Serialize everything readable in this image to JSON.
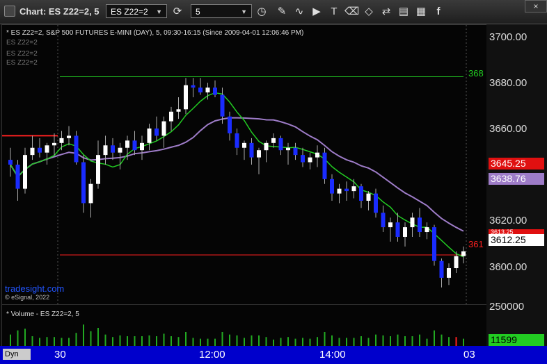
{
  "toolbar": {
    "title": "Chart: ES Z22=2, 5",
    "symbol": "ES Z22=2",
    "interval": "5",
    "buttons": [
      "draw",
      "indicators",
      "play",
      "text",
      "eraser",
      "tag",
      "save",
      "facebook"
    ]
  },
  "chart": {
    "header": "* ES Z22=2, S&P 500 FUTURES E-MINI (DAY), 5, 09:30-16:15 (Since 2009-04-01 12:06:46 PM)",
    "legend_items": [
      "ES Z22=2",
      "ES Z22=2",
      "ES Z22=2"
    ],
    "watermark": "tradesight.com",
    "copyright": "© eSignal, 2022",
    "green_line_label": "368",
    "red_line_label": "361",
    "volume_header": "* Volume - ES Z22=2, 5",
    "dyn_label": "Dyn"
  },
  "axis": {
    "price_labels": [
      "3700.00",
      "3680.00",
      "3660.00",
      "3620.00",
      "3600.00"
    ],
    "volume_label": "250000",
    "tag_red": "3645.25",
    "tag_purple": "3638.76",
    "tag_hidden": "3613.25",
    "tag_last": "3612.25",
    "tag_volume": "11599"
  },
  "time_labels": [
    "30",
    "12:00",
    "14:00",
    "03"
  ],
  "colors": {
    "red": "#ff2020",
    "green": "#22cc22",
    "purple": "#9e7cc8",
    "candle_up": "#ffffff",
    "candle_down": "#1a2cff"
  },
  "chart_data": {
    "type": "line",
    "ylim": [
      3590,
      3706
    ],
    "candles": [
      [
        3650,
        3655,
        3643,
        3648
      ],
      [
        3648,
        3650,
        3633,
        3638
      ],
      [
        3638,
        3655,
        3636,
        3652
      ],
      [
        3652,
        3660,
        3650,
        3655
      ],
      [
        3655,
        3659,
        3651,
        3653
      ],
      [
        3653,
        3657,
        3648,
        3656
      ],
      [
        3656,
        3661,
        3652,
        3657
      ],
      [
        3657,
        3662,
        3654,
        3659
      ],
      [
        3659,
        3664,
        3656,
        3660
      ],
      [
        3660,
        3662,
        3648,
        3649
      ],
      [
        3649,
        3652,
        3628,
        3632
      ],
      [
        3632,
        3642,
        3626,
        3640
      ],
      [
        3640,
        3658,
        3638,
        3652
      ],
      [
        3652,
        3660,
        3648,
        3656
      ],
      [
        3656,
        3659,
        3650,
        3653
      ],
      [
        3653,
        3657,
        3646,
        3655
      ],
      [
        3655,
        3660,
        3650,
        3658
      ],
      [
        3658,
        3662,
        3652,
        3654
      ],
      [
        3654,
        3660,
        3650,
        3657
      ],
      [
        3657,
        3665,
        3654,
        3663
      ],
      [
        3663,
        3668,
        3658,
        3660
      ],
      [
        3660,
        3668,
        3655,
        3666
      ],
      [
        3666,
        3672,
        3662,
        3670
      ],
      [
        3670,
        3676,
        3667,
        3671
      ],
      [
        3671,
        3684,
        3669,
        3681
      ],
      [
        3681,
        3684,
        3676,
        3680
      ],
      [
        3680,
        3684,
        3677,
        3678
      ],
      [
        3678,
        3682,
        3675,
        3680
      ],
      [
        3680,
        3683,
        3676,
        3677
      ],
      [
        3677,
        3680,
        3665,
        3668
      ],
      [
        3668,
        3670,
        3658,
        3661
      ],
      [
        3661,
        3663,
        3652,
        3655
      ],
      [
        3655,
        3658,
        3650,
        3657
      ],
      [
        3657,
        3659,
        3648,
        3651
      ],
      [
        3651,
        3655,
        3644,
        3654
      ],
      [
        3654,
        3658,
        3649,
        3657
      ],
      [
        3657,
        3661,
        3655,
        3659
      ],
      [
        3659,
        3660,
        3652,
        3654
      ],
      [
        3654,
        3657,
        3648,
        3655
      ],
      [
        3655,
        3657,
        3650,
        3652
      ],
      [
        3652,
        3655,
        3647,
        3649
      ],
      [
        3649,
        3653,
        3646,
        3651
      ],
      [
        3651,
        3656,
        3647,
        3653
      ],
      [
        3653,
        3655,
        3640,
        3642
      ],
      [
        3642,
        3644,
        3633,
        3636
      ],
      [
        3636,
        3640,
        3632,
        3638
      ],
      [
        3638,
        3641,
        3633,
        3637
      ],
      [
        3637,
        3642,
        3634,
        3639
      ],
      [
        3639,
        3640,
        3630,
        3633
      ],
      [
        3633,
        3637,
        3629,
        3636
      ],
      [
        3636,
        3638,
        3626,
        3628
      ],
      [
        3628,
        3631,
        3620,
        3622
      ],
      [
        3622,
        3626,
        3616,
        3624
      ],
      [
        3624,
        3628,
        3616,
        3618
      ],
      [
        3618,
        3624,
        3614,
        3622
      ],
      [
        3622,
        3628,
        3618,
        3626
      ],
      [
        3626,
        3630,
        3618,
        3620
      ],
      [
        3620,
        3624,
        3617,
        3622
      ],
      [
        3622,
        3623,
        3606,
        3608
      ],
      [
        3608,
        3609,
        3597,
        3601
      ],
      [
        3601,
        3607,
        3598,
        3605
      ],
      [
        3605,
        3612,
        3603,
        3610
      ],
      [
        3610,
        3614,
        3607,
        3612
      ]
    ],
    "levels": [
      {
        "name": "resistance",
        "value": 3684.5,
        "color": "#22cc22"
      },
      {
        "name": "support",
        "value": 3610.5,
        "color": "#ff2020"
      }
    ]
  }
}
